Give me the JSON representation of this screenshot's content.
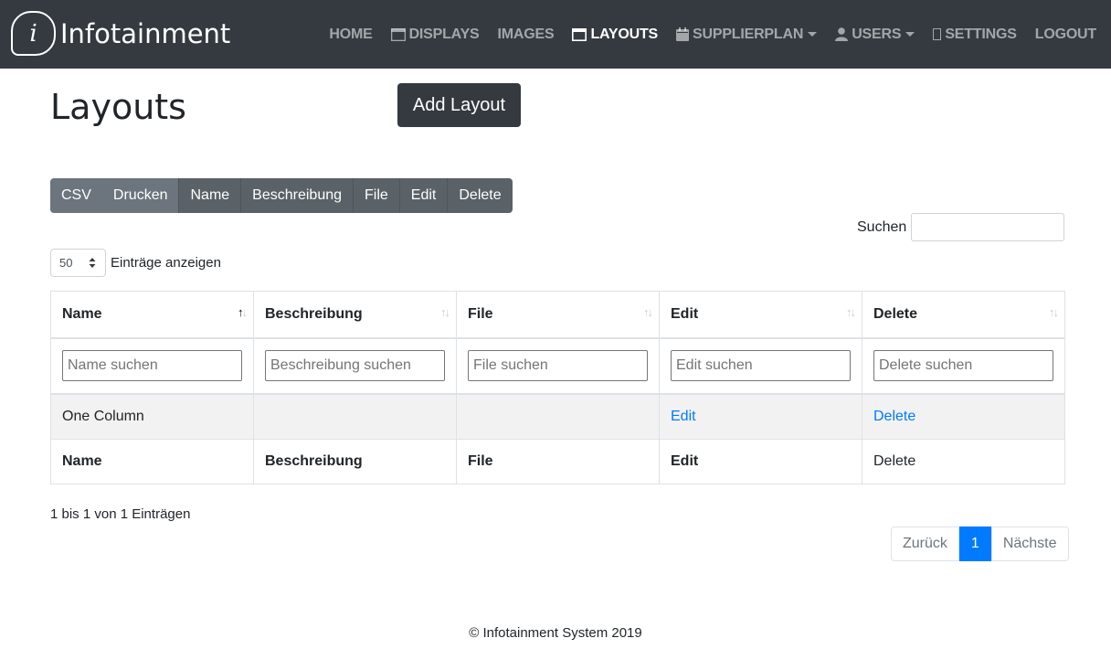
{
  "brand": {
    "logo_letter": "i",
    "name": "Infotainment"
  },
  "nav": {
    "home": "HOME",
    "displays": "DISPLAYS",
    "images": "IMAGES",
    "layouts": "LAYOUTS",
    "supplierplan": "SUPPLIERPLAN",
    "users": "USERS",
    "settings": "SETTINGS",
    "logout": "LOGOUT",
    "active": "LAYOUTS"
  },
  "page": {
    "title": "Layouts",
    "add_button": "Add Layout"
  },
  "toolbar": {
    "buttons": [
      "CSV",
      "Drucken",
      "Name",
      "Beschreibung",
      "File",
      "Edit",
      "Delete"
    ]
  },
  "search": {
    "label": "Suchen",
    "value": ""
  },
  "length": {
    "value": "50",
    "label": "Einträge anzeigen"
  },
  "table": {
    "headers": [
      "Name",
      "Beschreibung",
      "File",
      "Edit",
      "Delete"
    ],
    "filters": [
      "Name suchen",
      "Beschreibung suchen",
      "File suchen",
      "Edit suchen",
      "Delete suchen"
    ],
    "rows": [
      {
        "name": "One Column",
        "beschreibung": "",
        "file": "",
        "edit": "Edit",
        "delete": "Delete"
      }
    ],
    "footer": [
      "Name",
      "Beschreibung",
      "File",
      "Edit",
      "Delete"
    ]
  },
  "info": "1 bis 1 von 1 Einträgen",
  "pagination": {
    "prev": "Zurück",
    "current": "1",
    "next": "Nächste"
  },
  "footer": "© Infotainment System 2019",
  "colors": {
    "navbar": "#343a40",
    "link": "#007bff",
    "active_page": "#007bff"
  }
}
